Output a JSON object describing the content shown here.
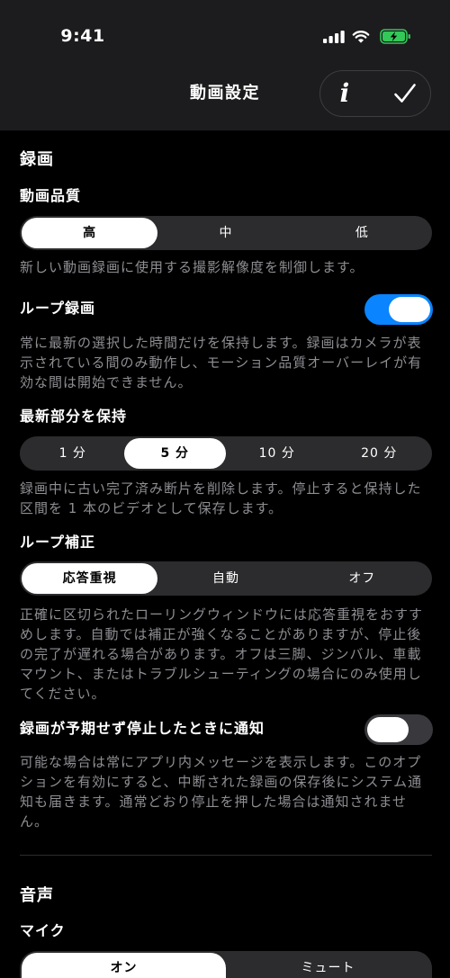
{
  "status_bar": {
    "time": "9:41"
  },
  "nav": {
    "title": "動画設定",
    "info_glyph": "i"
  },
  "recording": {
    "title": "録画",
    "video_quality": {
      "label": "動画品質",
      "options": [
        "高",
        "中",
        "低"
      ],
      "selected_index": 0,
      "description": "新しい動画録画に使用する撮影解像度を制御します。"
    },
    "loop_recording": {
      "label": "ループ録画",
      "enabled": true,
      "description": "常に最新の選択した時間だけを保持します。録画はカメラが表示されている間のみ動作し、モーション品質オーバーレイが有効な間は開始できません。"
    },
    "keep_latest": {
      "label": "最新部分を保持",
      "options": [
        "1 分",
        "5 分",
        "10 分",
        "20 分"
      ],
      "selected_index": 1,
      "description": "録画中に古い完了済み断片を削除します。停止すると保持した区間を 1 本のビデオとして保存します。"
    },
    "loop_correction": {
      "label": "ループ補正",
      "options": [
        "応答重視",
        "自動",
        "オフ"
      ],
      "selected_index": 0,
      "description": "正確に区切られたローリングウィンドウには応答重視をおすすめします。自動では補正が強くなることがありますが、停止後の完了が遅れる場合があります。オフは三脚、ジンバル、車載マウント、またはトラブルシューティングの場合にのみ使用してください。"
    },
    "notify_on_stop": {
      "label": "録画が予期せず停止したときに通知",
      "enabled": false,
      "description": "可能な場合は常にアプリ内メッセージを表示します。このオプションを有効にすると、中断された録画の保存後にシステム通知も届きます。通常どおり停止を押した場合は通知されません。"
    }
  },
  "audio": {
    "title": "音声",
    "microphone": {
      "label": "マイク",
      "options": [
        "オン",
        "ミュート"
      ],
      "selected_index": 0
    }
  },
  "icons": {
    "signal": "cellular-signal-icon",
    "wifi": "wifi-icon",
    "battery": "battery-charging-icon",
    "info": "info-icon",
    "done": "checkmark-icon"
  },
  "colors": {
    "accent": "#0a84ff",
    "background": "#000000",
    "header_background": "#1c1c1e",
    "control_track": "#2c2c2e",
    "toggle_off": "#39393d",
    "secondary_text": "#8e8e93",
    "battery": "#34c759"
  }
}
